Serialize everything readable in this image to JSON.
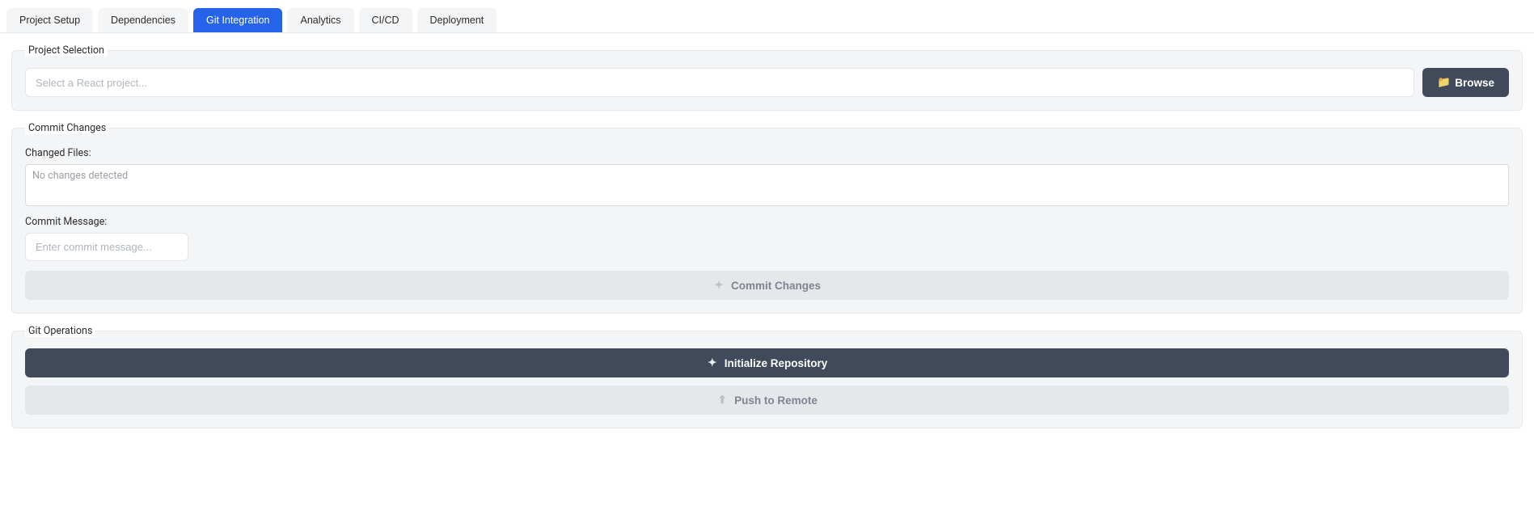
{
  "tabs": [
    {
      "label": "Project Setup",
      "active": false
    },
    {
      "label": "Dependencies",
      "active": false
    },
    {
      "label": "Git Integration",
      "active": true
    },
    {
      "label": "Analytics",
      "active": false
    },
    {
      "label": "CI/CD",
      "active": false
    },
    {
      "label": "Deployment",
      "active": false
    }
  ],
  "project_selection": {
    "legend": "Project Selection",
    "placeholder": "Select a React project...",
    "value": "",
    "browse_label": "Browse"
  },
  "commit_changes": {
    "legend": "Commit Changes",
    "changed_files_label": "Changed Files:",
    "changed_files_content": "No changes detected",
    "commit_message_label": "Commit Message:",
    "commit_message_placeholder": "Enter commit message...",
    "commit_message_value": "",
    "commit_button_label": "Commit Changes"
  },
  "git_operations": {
    "legend": "Git Operations",
    "init_label": "Initialize Repository",
    "push_label": "Push to Remote"
  },
  "icons": {
    "folder": "📁",
    "commit": "✦",
    "sparkle": "✦",
    "upload": "⬆"
  }
}
